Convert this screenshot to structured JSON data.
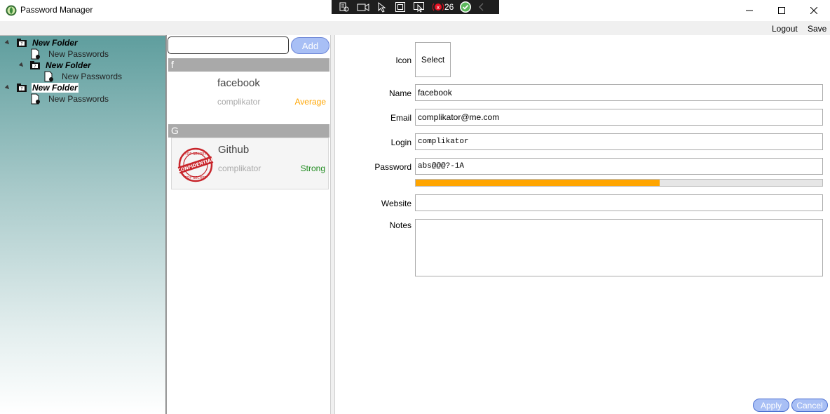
{
  "window": {
    "title": "Password Manager"
  },
  "debug_toolbar": {
    "binding_failures": "26"
  },
  "menu": {
    "logout_label": "Logout",
    "save_label": "Save"
  },
  "tree": {
    "nodes": [
      {
        "label": "New Folder",
        "type": "folder",
        "level": 0,
        "selected": false
      },
      {
        "label": "New Passwords",
        "type": "item",
        "level": 1
      },
      {
        "label": "New Folder",
        "type": "folder",
        "level": 1,
        "selected": false
      },
      {
        "label": "New Passwords",
        "type": "item",
        "level": 2
      },
      {
        "label": "New Folder",
        "type": "folder",
        "level": 0,
        "selected": true
      },
      {
        "label": "New Passwords",
        "type": "item",
        "level": 1
      }
    ]
  },
  "list": {
    "search_value": "",
    "add_label": "Add",
    "groups": [
      {
        "header": "f",
        "entries": [
          {
            "name": "facebook",
            "user": "complikator",
            "strength": "Average",
            "strength_color": "#ffa500",
            "logo": ""
          }
        ]
      },
      {
        "header": "G",
        "entries": [
          {
            "name": "Github",
            "user": "complikator",
            "strength": "Strong",
            "strength_color": "#1e8a1e",
            "logo": "confidential-stamp"
          }
        ]
      }
    ],
    "stamp_text": "CONFIDENTIAL",
    "stamp_ring_text": "TOP SECRET"
  },
  "details": {
    "icon_label": "Icon",
    "select_label": "Select",
    "name_label": "Name",
    "name_value": "facebook",
    "email_label": "Email",
    "email_value": "complikator@me.com",
    "login_label": "Login",
    "login_value": "complikator",
    "password_label": "Password",
    "password_value": "abs@@@?-1A",
    "password_strength": 0.6,
    "strength_color": "#ffa500",
    "website_label": "Website",
    "website_value": "",
    "notes_label": "Notes",
    "notes_value": "",
    "apply_label": "Apply",
    "cancel_label": "Cancel"
  }
}
